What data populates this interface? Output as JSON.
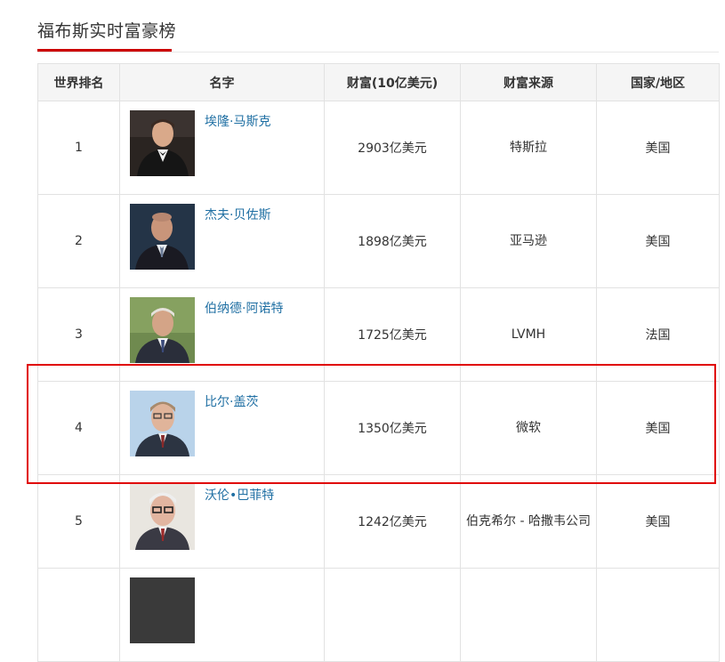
{
  "page": {
    "section_title": "福布斯实时富豪榜"
  },
  "table": {
    "headers": {
      "rank": "世界排名",
      "name": "名字",
      "wealth": "财富(10亿美元)",
      "source": "财富来源",
      "country": "国家/地区"
    },
    "rows": [
      {
        "rank": "1",
        "name": "埃隆·马斯克",
        "wealth": "2903亿美元",
        "source": "特斯拉",
        "country": "美国"
      },
      {
        "rank": "2",
        "name": "杰夫·贝佐斯",
        "wealth": "1898亿美元",
        "source": "亚马逊",
        "country": "美国"
      },
      {
        "rank": "3",
        "name": "伯纳德·阿诺特",
        "wealth": "1725亿美元",
        "source": "LVMH",
        "country": "法国"
      },
      {
        "rank": "4",
        "name": "比尔·盖茨",
        "wealth": "1350亿美元",
        "source": "微软",
        "country": "美国"
      },
      {
        "rank": "5",
        "name": "沃伦•巴菲特",
        "wealth": "1242亿美元",
        "source": "伯克希尔 - 哈撒韦公司",
        "country": "美国"
      }
    ]
  },
  "colors": {
    "accent": "#cc0000",
    "highlight": "#e00000",
    "link": "#1f6fa3",
    "header_bg": "#f5f5f5",
    "border": "#e2e2e2"
  }
}
